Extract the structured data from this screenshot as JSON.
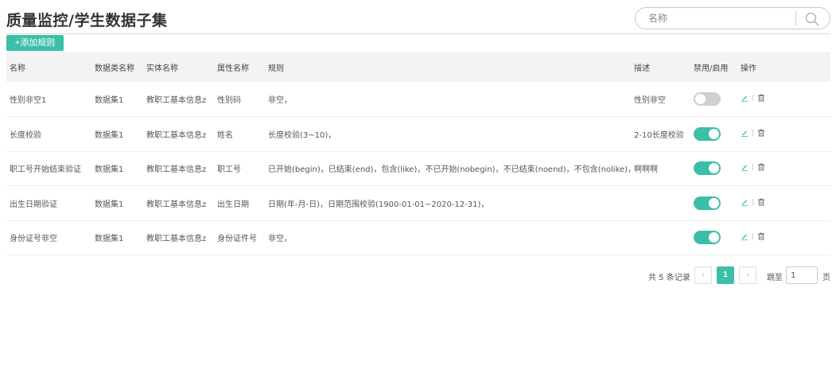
{
  "page": {
    "title": "质量监控/学生数据子集"
  },
  "search": {
    "placeholder": "名称",
    "icon": "search-icon"
  },
  "toolbar": {
    "add_label": "+添加规则"
  },
  "table": {
    "headers": [
      "名称",
      "数据类名称",
      "实体名称",
      "属性名称",
      "规则",
      "描述",
      "禁用/启用",
      "操作"
    ],
    "rows": [
      {
        "name": "性别非空1",
        "dataset": "数据集1",
        "entity": "教职工基本信息z",
        "attribute": "性别码",
        "rule": "非空，",
        "description": "性别非空",
        "enabled": false
      },
      {
        "name": "长度校验",
        "dataset": "数据集1",
        "entity": "教职工基本信息z",
        "attribute": "姓名",
        "rule": "长度校验(3~10)，",
        "description": "2-10长度校验",
        "enabled": true
      },
      {
        "name": "职工号开始结束验证",
        "dataset": "数据集1",
        "entity": "教职工基本信息z",
        "attribute": "职工号",
        "rule": "已开始(begin)，已结束(end)，包含(like)，不已开始(nobegin)，不已结束(noend)，不包含(nolike)，",
        "description": "啊啊啊",
        "enabled": true
      },
      {
        "name": "出生日期验证",
        "dataset": "数据集1",
        "entity": "教职工基本信息z",
        "attribute": "出生日期",
        "rule": "日期(年-月-日)，日期范围校验(1900-01-01~2020-12-31)，",
        "description": "",
        "enabled": true
      },
      {
        "name": "身份证号非空",
        "dataset": "数据集1",
        "entity": "教职工基本信息z",
        "attribute": "身份证件号",
        "rule": "非空，",
        "description": "",
        "enabled": true
      }
    ],
    "row_actions": [
      "edit-icon",
      "delete-icon"
    ]
  },
  "pagination": {
    "total_text": "共 5 条记录",
    "prev": "‹",
    "current_page": "1",
    "next": "›",
    "goto_label": "跳至",
    "goto_value": "1",
    "page_unit": "页"
  },
  "colors": {
    "accent": "#3cbfa9",
    "toggle_off": "#cfcfcf",
    "header_bg": "#f3f3f3"
  }
}
